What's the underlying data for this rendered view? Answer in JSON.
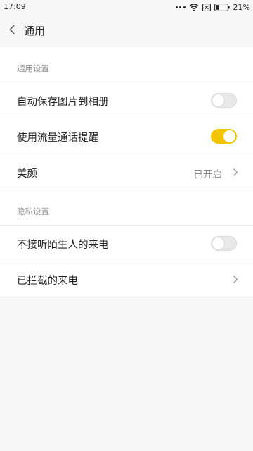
{
  "status_bar": {
    "time": "17:09",
    "battery_pct": "21%",
    "icons": [
      "dots-icon",
      "wifi-icon",
      "sim-x-icon",
      "battery-icon"
    ]
  },
  "header": {
    "title": "通用"
  },
  "sections": [
    {
      "title": "通用设置",
      "rows": [
        {
          "label": "自动保存图片到相册",
          "control": "toggle",
          "on": false
        },
        {
          "label": "使用流量通话提醒",
          "control": "toggle",
          "on": true
        },
        {
          "label": "美颜",
          "control": "link",
          "value": "已开启"
        }
      ]
    },
    {
      "title": "隐私设置",
      "rows": [
        {
          "label": "不接听陌生人的来电",
          "control": "toggle",
          "on": false
        },
        {
          "label": "已拦截的来电",
          "control": "link",
          "value": ""
        }
      ]
    }
  ],
  "colors": {
    "accent": "#f5c400",
    "background": "#f7f7f7",
    "text_primary": "#222222",
    "text_secondary": "#8f8f8f"
  }
}
